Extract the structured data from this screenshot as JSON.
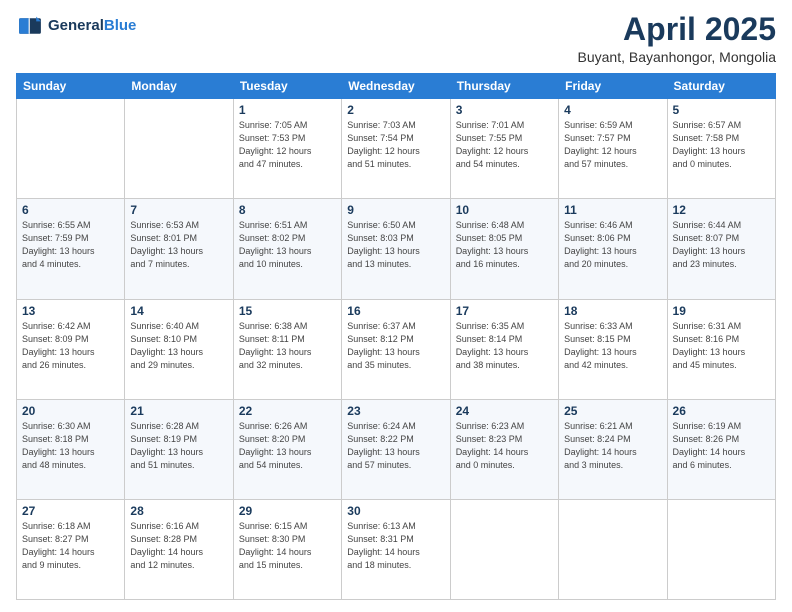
{
  "logo": {
    "line1": "General",
    "line2": "Blue"
  },
  "title": "April 2025",
  "subtitle": "Buyant, Bayanhongor, Mongolia",
  "days_header": [
    "Sunday",
    "Monday",
    "Tuesday",
    "Wednesday",
    "Thursday",
    "Friday",
    "Saturday"
  ],
  "weeks": [
    [
      {
        "day": "",
        "info": ""
      },
      {
        "day": "",
        "info": ""
      },
      {
        "day": "1",
        "info": "Sunrise: 7:05 AM\nSunset: 7:53 PM\nDaylight: 12 hours\nand 47 minutes."
      },
      {
        "day": "2",
        "info": "Sunrise: 7:03 AM\nSunset: 7:54 PM\nDaylight: 12 hours\nand 51 minutes."
      },
      {
        "day": "3",
        "info": "Sunrise: 7:01 AM\nSunset: 7:55 PM\nDaylight: 12 hours\nand 54 minutes."
      },
      {
        "day": "4",
        "info": "Sunrise: 6:59 AM\nSunset: 7:57 PM\nDaylight: 12 hours\nand 57 minutes."
      },
      {
        "day": "5",
        "info": "Sunrise: 6:57 AM\nSunset: 7:58 PM\nDaylight: 13 hours\nand 0 minutes."
      }
    ],
    [
      {
        "day": "6",
        "info": "Sunrise: 6:55 AM\nSunset: 7:59 PM\nDaylight: 13 hours\nand 4 minutes."
      },
      {
        "day": "7",
        "info": "Sunrise: 6:53 AM\nSunset: 8:01 PM\nDaylight: 13 hours\nand 7 minutes."
      },
      {
        "day": "8",
        "info": "Sunrise: 6:51 AM\nSunset: 8:02 PM\nDaylight: 13 hours\nand 10 minutes."
      },
      {
        "day": "9",
        "info": "Sunrise: 6:50 AM\nSunset: 8:03 PM\nDaylight: 13 hours\nand 13 minutes."
      },
      {
        "day": "10",
        "info": "Sunrise: 6:48 AM\nSunset: 8:05 PM\nDaylight: 13 hours\nand 16 minutes."
      },
      {
        "day": "11",
        "info": "Sunrise: 6:46 AM\nSunset: 8:06 PM\nDaylight: 13 hours\nand 20 minutes."
      },
      {
        "day": "12",
        "info": "Sunrise: 6:44 AM\nSunset: 8:07 PM\nDaylight: 13 hours\nand 23 minutes."
      }
    ],
    [
      {
        "day": "13",
        "info": "Sunrise: 6:42 AM\nSunset: 8:09 PM\nDaylight: 13 hours\nand 26 minutes."
      },
      {
        "day": "14",
        "info": "Sunrise: 6:40 AM\nSunset: 8:10 PM\nDaylight: 13 hours\nand 29 minutes."
      },
      {
        "day": "15",
        "info": "Sunrise: 6:38 AM\nSunset: 8:11 PM\nDaylight: 13 hours\nand 32 minutes."
      },
      {
        "day": "16",
        "info": "Sunrise: 6:37 AM\nSunset: 8:12 PM\nDaylight: 13 hours\nand 35 minutes."
      },
      {
        "day": "17",
        "info": "Sunrise: 6:35 AM\nSunset: 8:14 PM\nDaylight: 13 hours\nand 38 minutes."
      },
      {
        "day": "18",
        "info": "Sunrise: 6:33 AM\nSunset: 8:15 PM\nDaylight: 13 hours\nand 42 minutes."
      },
      {
        "day": "19",
        "info": "Sunrise: 6:31 AM\nSunset: 8:16 PM\nDaylight: 13 hours\nand 45 minutes."
      }
    ],
    [
      {
        "day": "20",
        "info": "Sunrise: 6:30 AM\nSunset: 8:18 PM\nDaylight: 13 hours\nand 48 minutes."
      },
      {
        "day": "21",
        "info": "Sunrise: 6:28 AM\nSunset: 8:19 PM\nDaylight: 13 hours\nand 51 minutes."
      },
      {
        "day": "22",
        "info": "Sunrise: 6:26 AM\nSunset: 8:20 PM\nDaylight: 13 hours\nand 54 minutes."
      },
      {
        "day": "23",
        "info": "Sunrise: 6:24 AM\nSunset: 8:22 PM\nDaylight: 13 hours\nand 57 minutes."
      },
      {
        "day": "24",
        "info": "Sunrise: 6:23 AM\nSunset: 8:23 PM\nDaylight: 14 hours\nand 0 minutes."
      },
      {
        "day": "25",
        "info": "Sunrise: 6:21 AM\nSunset: 8:24 PM\nDaylight: 14 hours\nand 3 minutes."
      },
      {
        "day": "26",
        "info": "Sunrise: 6:19 AM\nSunset: 8:26 PM\nDaylight: 14 hours\nand 6 minutes."
      }
    ],
    [
      {
        "day": "27",
        "info": "Sunrise: 6:18 AM\nSunset: 8:27 PM\nDaylight: 14 hours\nand 9 minutes."
      },
      {
        "day": "28",
        "info": "Sunrise: 6:16 AM\nSunset: 8:28 PM\nDaylight: 14 hours\nand 12 minutes."
      },
      {
        "day": "29",
        "info": "Sunrise: 6:15 AM\nSunset: 8:30 PM\nDaylight: 14 hours\nand 15 minutes."
      },
      {
        "day": "30",
        "info": "Sunrise: 6:13 AM\nSunset: 8:31 PM\nDaylight: 14 hours\nand 18 minutes."
      },
      {
        "day": "",
        "info": ""
      },
      {
        "day": "",
        "info": ""
      },
      {
        "day": "",
        "info": ""
      }
    ]
  ]
}
